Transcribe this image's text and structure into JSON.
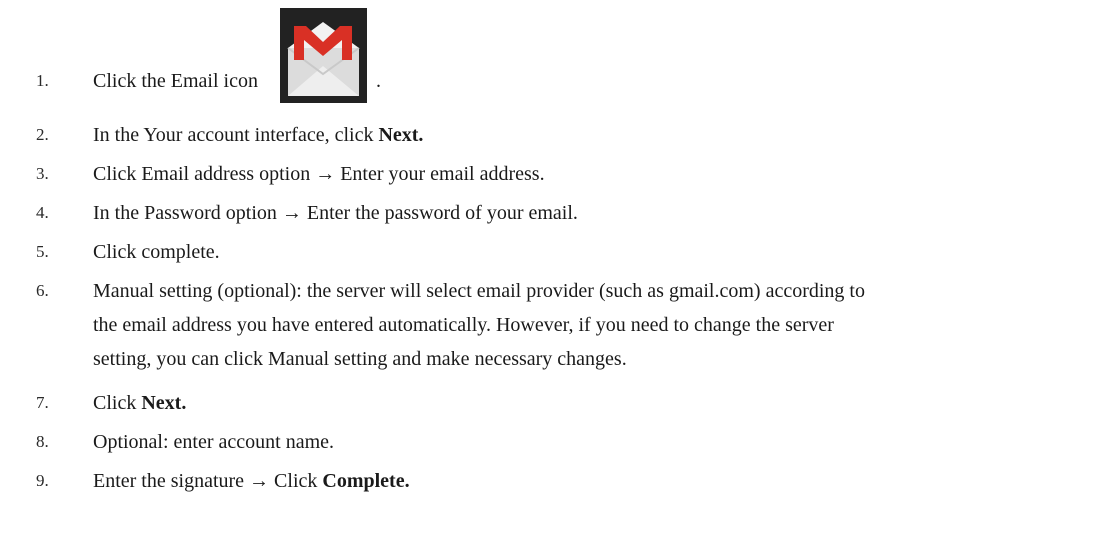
{
  "steps": [
    {
      "number": "1.",
      "text": "Click the Email icon",
      "icon": "gmail-envelope-icon",
      "trailing": "."
    },
    {
      "number": "2.",
      "text": "In the Your account interface, click ",
      "bold": "Next."
    },
    {
      "number": "3.",
      "text": "Click Email address option → Enter your email address."
    },
    {
      "number": "4.",
      "text": "In the Password option → Enter the password of your email."
    },
    {
      "number": "5.",
      "text": "Click complete."
    },
    {
      "number": "6.",
      "lines": [
        "Manual setting (optional): the server will select email provider (such as gmail.com) according to",
        "the email address you have entered automatically. However, if you need to change the server",
        "setting, you can click Manual setting and make necessary changes."
      ]
    },
    {
      "number": "7.",
      "text": "Click ",
      "bold": "Next."
    },
    {
      "number": "8.",
      "text": "Optional: enter account name."
    },
    {
      "number": "9.",
      "text": "Enter the signature → Click ",
      "bold": "Complete."
    }
  ],
  "colors": {
    "icon_red": "#d93025",
    "icon_background": "#222222",
    "envelope": "#e8e8e8"
  }
}
